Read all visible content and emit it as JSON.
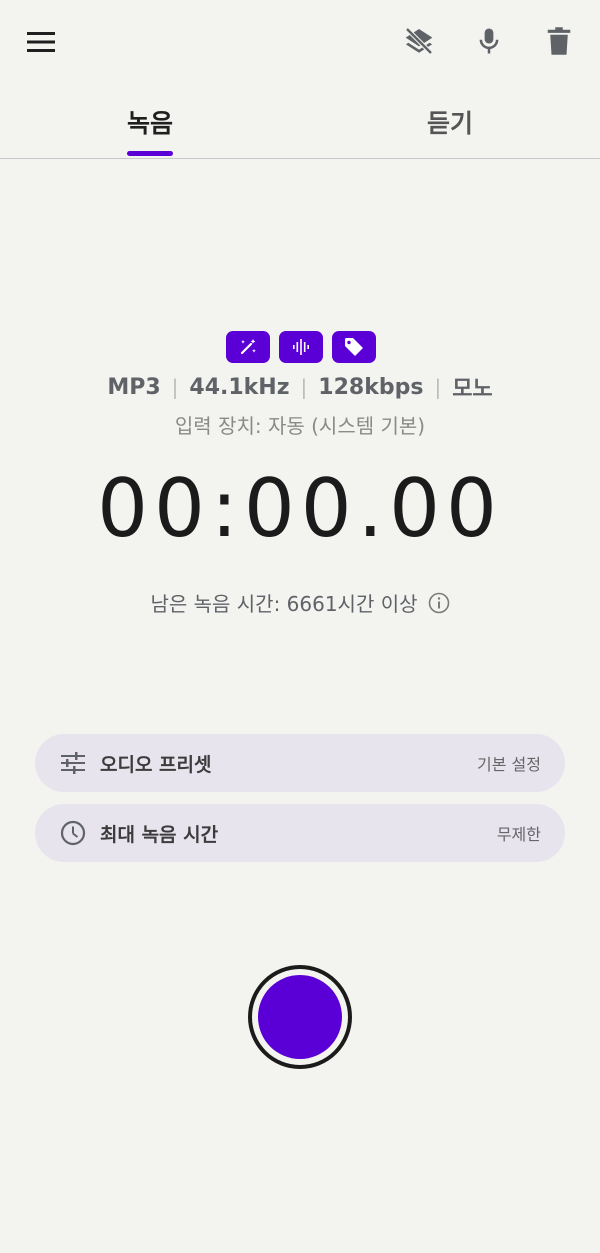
{
  "toolbar": {
    "menu_icon": "menu-icon",
    "actions": [
      "layers-off-icon",
      "microphone-icon",
      "trash-icon"
    ]
  },
  "tabs": [
    {
      "label": "녹음",
      "active": true
    },
    {
      "label": "듣기",
      "active": false
    }
  ],
  "badges": [
    "magic-wand-icon",
    "waveform-icon",
    "tag-icon"
  ],
  "specs": {
    "format": "MP3",
    "sample_rate": "44.1kHz",
    "bitrate": "128kbps",
    "channels": "모노",
    "separator": "|"
  },
  "input_device": "입력 장치: 자동 (시스템 기본)",
  "timer": "00:00.00",
  "remaining": "남은 녹음 시간: 6661시간 이상",
  "settings": [
    {
      "icon": "sliders-icon",
      "label": "오디오 프리셋",
      "value": "기본 설정"
    },
    {
      "icon": "clock-icon",
      "label": "최대 녹음 시간",
      "value": "무제한"
    }
  ],
  "colors": {
    "accent": "#5a00d6",
    "background": "#f3f3ef",
    "row_background": "#e8e4ee"
  }
}
